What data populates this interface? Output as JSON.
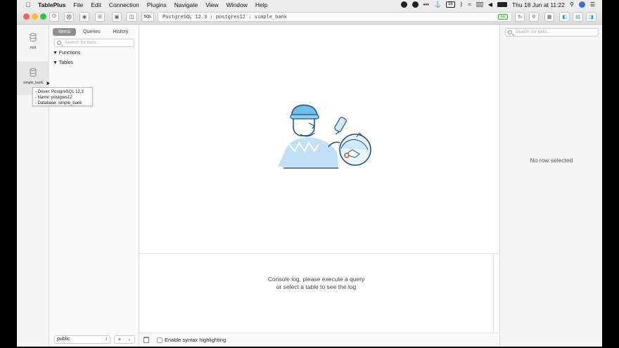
{
  "menubar": {
    "app_name": "TablePlus",
    "items": [
      "File",
      "Edit",
      "Connection",
      "Plugins",
      "Navigate",
      "View",
      "Window",
      "Help"
    ],
    "calendar_badge": "18",
    "datetime": "Thu 18 Jun at 11:22"
  },
  "toolbar": {
    "sql_label": "SQL",
    "connection_info": "PostgreSQL 12.3 : postgres12 : simple_bank",
    "badge": "loc"
  },
  "connections": [
    {
      "label": "root"
    },
    {
      "label": "simple_bank"
    }
  ],
  "tooltip": {
    "driver": "- Driver: PostgreSQL 12.3",
    "name": "- Name: postgres12",
    "database": "- Database: simple_bank"
  },
  "items_panel": {
    "tabs": [
      "Items",
      "Queries",
      "History"
    ],
    "search_placeholder": "Search for item...",
    "tree": [
      "Functions",
      "Tables"
    ],
    "schema": "public"
  },
  "console": {
    "line1": "Console log, please execute a query",
    "line2": "or select a table to see the log"
  },
  "bottombar": {
    "syntax_label": "Enable syntax highlighting"
  },
  "right_panel": {
    "search_placeholder": "Search for field...",
    "empty_text": "No row selected"
  },
  "colors": {
    "accent": "#2f8ee0",
    "traffic_red": "#fe5f57",
    "traffic_yellow": "#febc2e",
    "traffic_green": "#28c840"
  }
}
